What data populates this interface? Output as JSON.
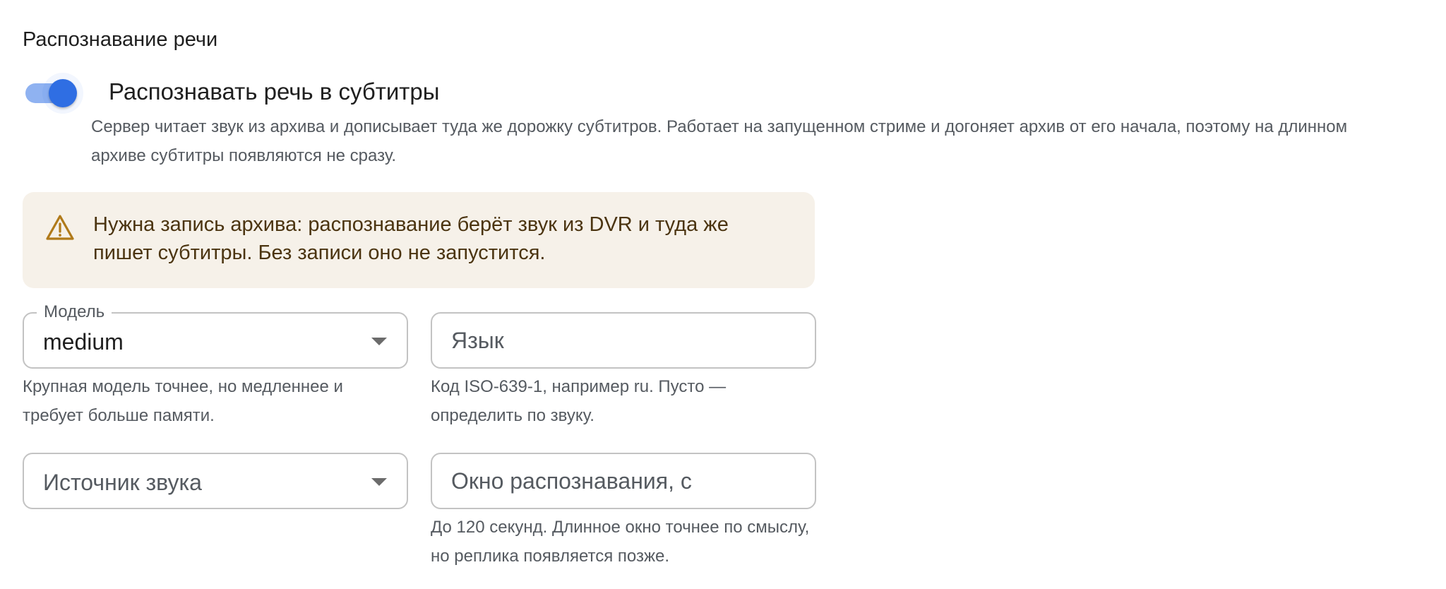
{
  "section": {
    "title": "Распознавание речи"
  },
  "toggle": {
    "label": "Распознавать речь в субтитры",
    "enabled": true,
    "description": "Сервер читает звук из архива и дописывает туда же дорожку субтитров. Работает на запущенном стриме и догоняет архив от его начала, поэтому на длинном архиве субтитры появляются не сразу."
  },
  "alert": {
    "icon": "warning-triangle-icon",
    "text": "Нужна запись архива: распознавание берёт звук из DVR и туда же пишет субтитры. Без записи оно не запустится."
  },
  "model": {
    "label": "Модель",
    "value": "medium",
    "helper": "Крупная модель точнее, но медленнее и требует больше памяти."
  },
  "language": {
    "placeholder": "Язык",
    "value": "",
    "helper": "Код ISO-639-1, например ru. Пусто — определить по звуку."
  },
  "audio_source": {
    "placeholder": "Источник звука",
    "value": ""
  },
  "window": {
    "placeholder": "Окно распознавания, с",
    "value": "",
    "helper": "До 120 секунд. Длинное окно точнее по смыслу, но реплика появляется позже."
  },
  "colors": {
    "accent": "#2f6ee3",
    "warning": "#b07a1a",
    "alert_bg": "#f6f1e9"
  }
}
